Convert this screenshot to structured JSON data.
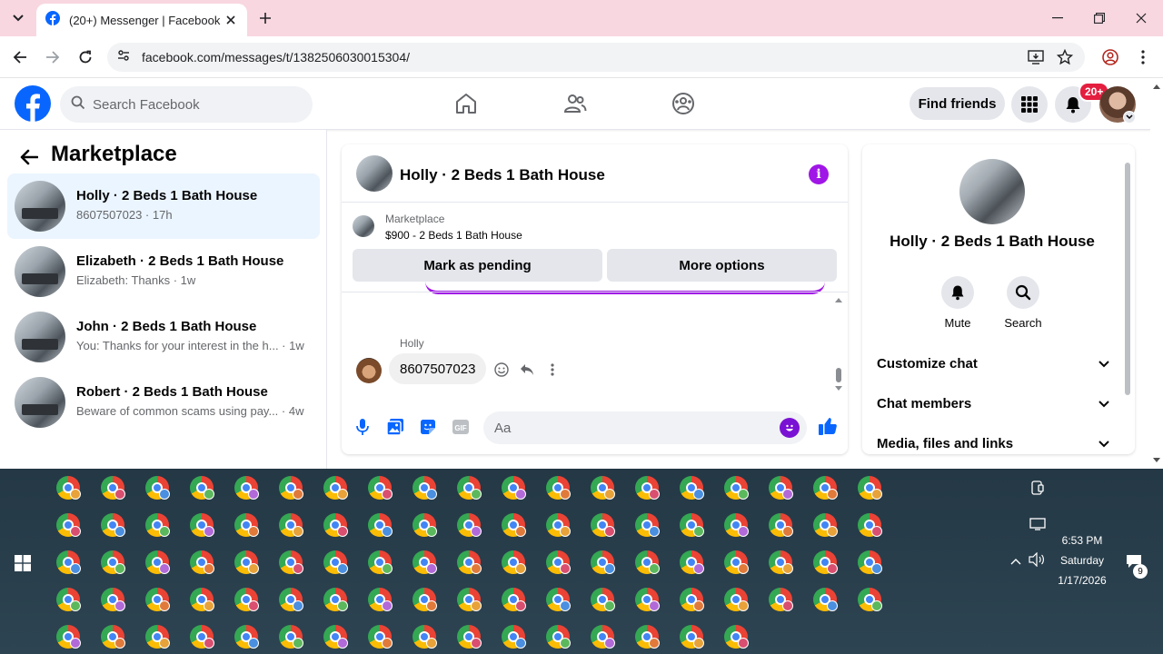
{
  "browser": {
    "tab_title": "(20+) Messenger | Facebook",
    "url": "facebook.com/messages/t/1382506030015304/"
  },
  "header": {
    "search_placeholder": "Search Facebook",
    "find_friends": "Find friends",
    "notif_badge": "20+"
  },
  "left": {
    "title": "Marketplace",
    "conversations": [
      {
        "name": "Holly · 2 Beds 1 Bath House",
        "sub": "8607507023 · 17h",
        "active": true
      },
      {
        "name": "Elizabeth · 2 Beds 1 Bath House",
        "sub": "Elizabeth: Thanks · 1w",
        "active": false
      },
      {
        "name": "John · 2 Beds 1 Bath House",
        "sub": "You: Thanks for your interest in the h... · 1w",
        "active": false
      },
      {
        "name": "Robert · 2 Beds 1 Bath House",
        "sub": "Beware of common scams using pay... · 4w",
        "active": false
      }
    ]
  },
  "chat": {
    "title": "Holly · 2 Beds 1 Bath House",
    "marketplace_label": "Marketplace",
    "listing": "$900 - 2 Beds 1 Bath House",
    "mark_pending": "Mark as pending",
    "more_options": "More options",
    "message_sender": "Holly",
    "message_text": "8607507023",
    "composer_placeholder": "Aa"
  },
  "right": {
    "name": "Holly · 2 Beds 1 Bath House",
    "mute": "Mute",
    "search": "Search",
    "sections": [
      "Customize chat",
      "Chat members",
      "Media, files and links"
    ]
  },
  "taskbar": {
    "time": "6:53 PM",
    "day": "Saturday",
    "date": "1/17/2026",
    "notif_count": "9"
  },
  "colors": {
    "fb_blue": "#0866ff",
    "messenger_purple": "#a016e6",
    "active_conv_bg": "#ebf5ff",
    "tab_bar": "#f8d7e0"
  }
}
